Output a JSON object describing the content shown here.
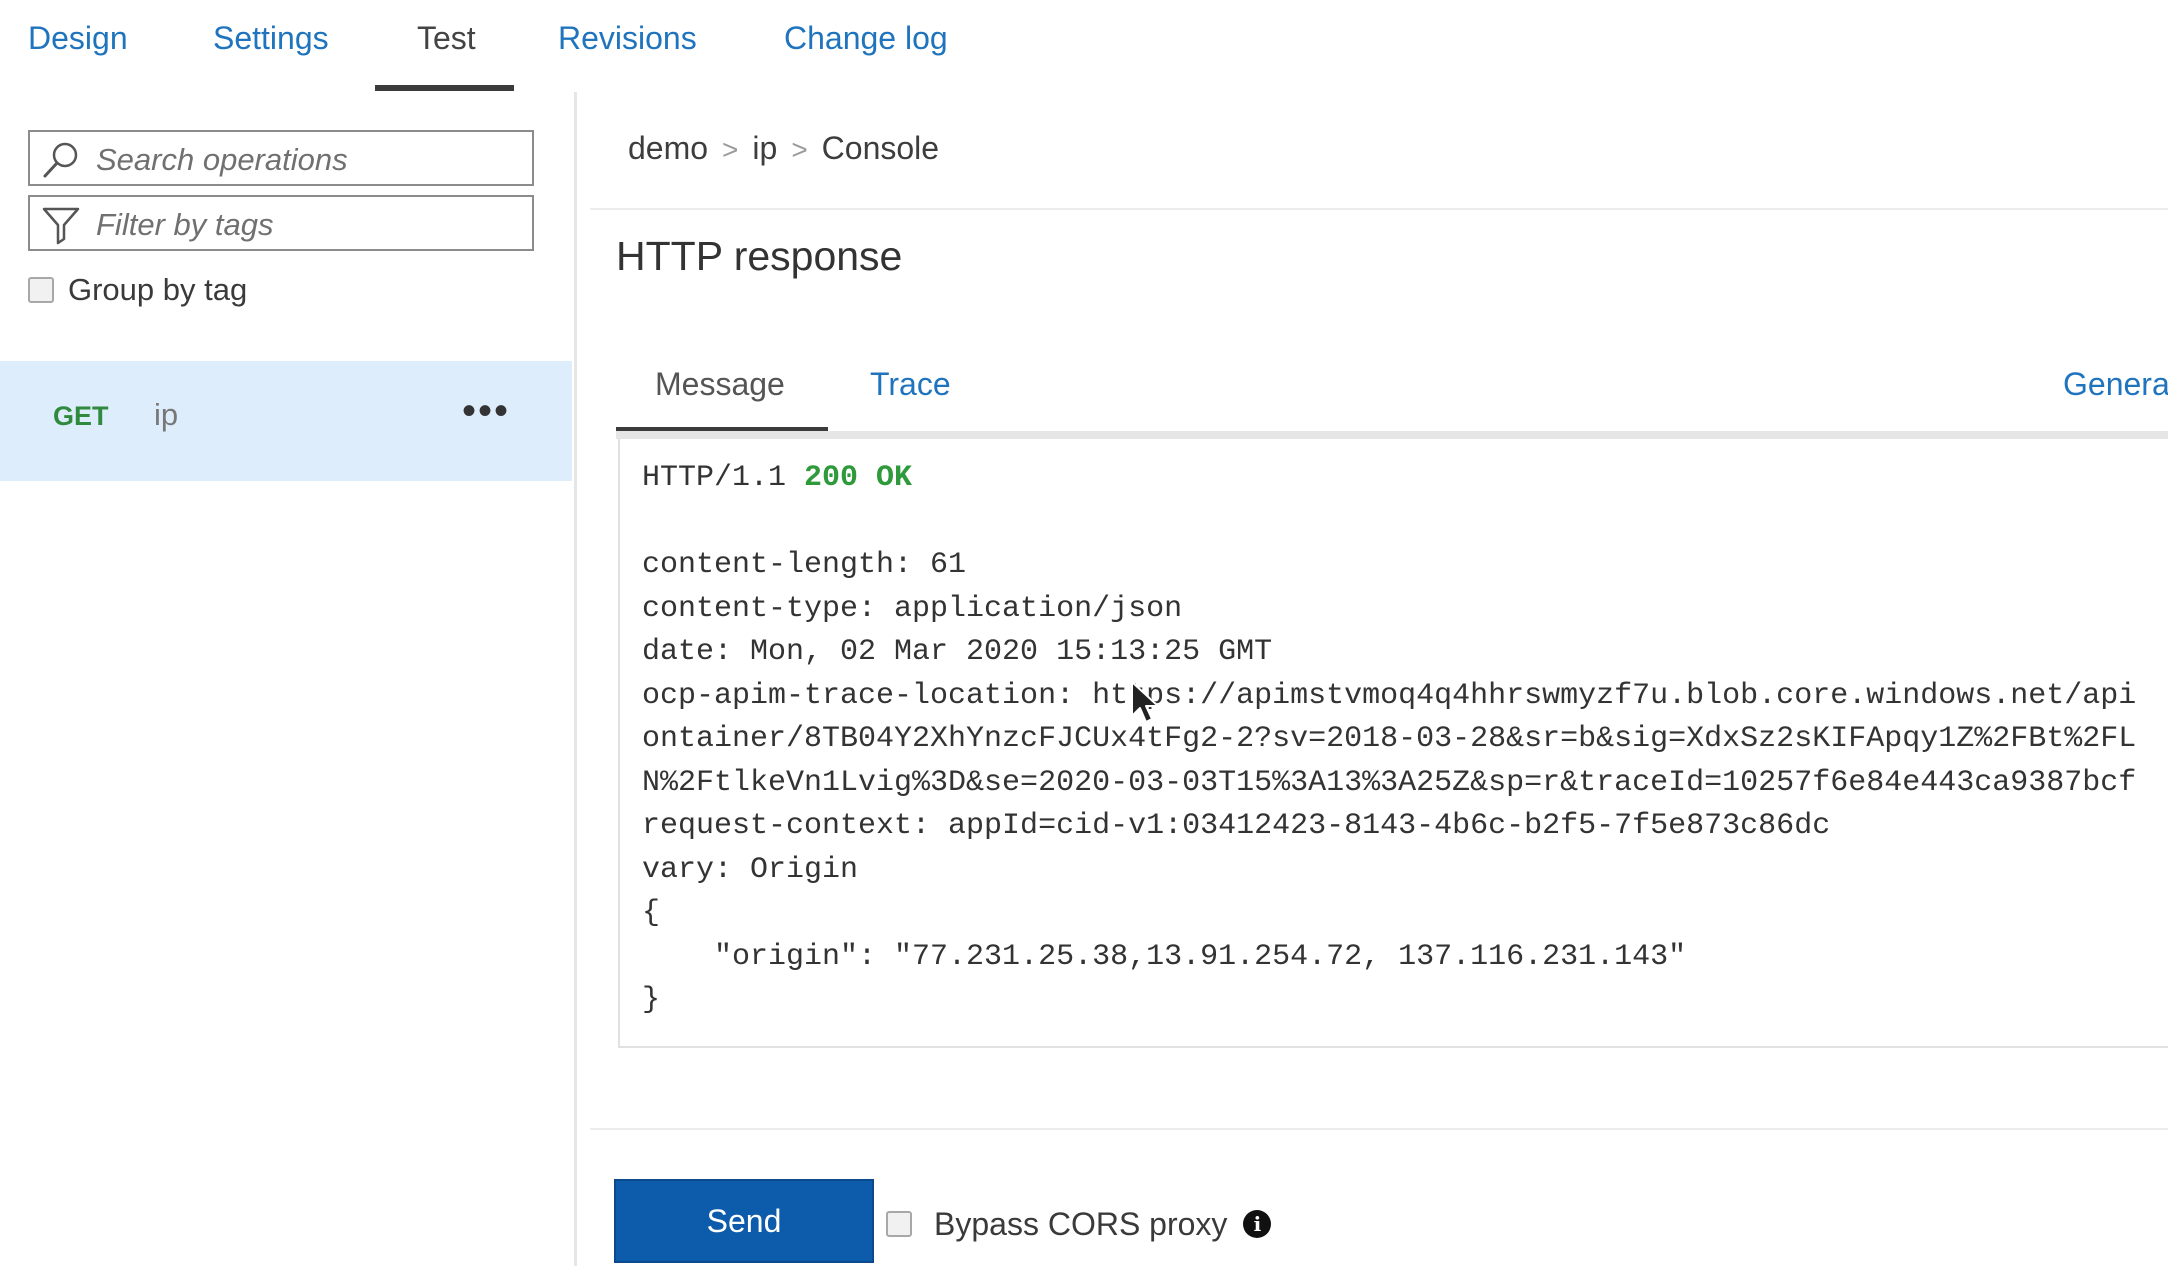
{
  "top_tabs": {
    "design": "Design",
    "settings": "Settings",
    "test": "Test",
    "revisions": "Revisions",
    "change_log": "Change log"
  },
  "sidebar": {
    "search_placeholder": "Search operations",
    "filter_placeholder": "Filter by tags",
    "group_by_tag_label": "Group by tag",
    "group_by_tag_checked": false,
    "operations": [
      {
        "method": "GET",
        "name": "ip",
        "more": "•••"
      }
    ]
  },
  "breadcrumb": {
    "items": [
      "demo",
      "ip",
      "Console"
    ],
    "separator": ">"
  },
  "response": {
    "title": "HTTP response",
    "tabs": {
      "message": "Message",
      "trace": "Trace",
      "generate": "Genera"
    },
    "status_line": {
      "protocol": "HTTP/1.1",
      "status": "200 OK"
    },
    "body_lines": [
      "",
      "content-length: 61",
      "content-type: application/json",
      "date: Mon, 02 Mar 2020 15:13:25 GMT",
      "ocp-apim-trace-location: https://apimstvmoq4q4hhrswmyzf7u.blob.core.windows.net/api",
      "ontainer/8TB04Y2XhYnzcFJCUx4tFg2-2?sv=2018-03-28&sr=b&sig=XdxSz2sKIFApqy1Z%2FBt%2FL",
      "N%2FtlkeVn1Lvig%3D&se=2020-03-03T15%3A13%3A25Z&sp=r&traceId=10257f6e84e443ca9387bcf",
      "request-context: appId=cid-v1:03412423-8143-4b6c-b2f5-7f5e873c86dc",
      "vary: Origin",
      "{",
      "    \"origin\": \"77.231.25.38,13.91.254.72, 137.116.231.143\"",
      "}"
    ]
  },
  "footer": {
    "send_label": "Send",
    "bypass_cors_label": "Bypass CORS proxy",
    "bypass_cors_checked": false
  },
  "colors": {
    "link": "#1f74bd",
    "accent_button": "#0d5bab",
    "status_ok": "#2e9a3c",
    "get_method": "#2f8a3e",
    "selected_row": "#deedfb"
  },
  "icons": [
    "search-icon",
    "filter-icon",
    "info-icon",
    "mouse-cursor-icon"
  ]
}
